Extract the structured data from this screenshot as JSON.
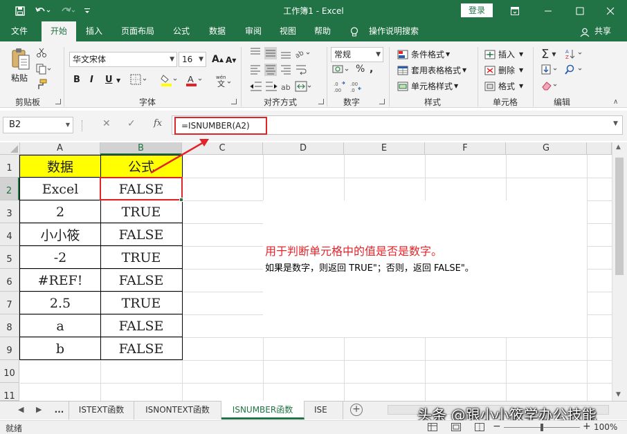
{
  "window": {
    "title": "工作簿1  -  Excel",
    "login_label": "登录"
  },
  "tabs": [
    "文件",
    "开始",
    "插入",
    "页面布局",
    "公式",
    "数据",
    "审阅",
    "视图",
    "帮助"
  ],
  "active_tab": "开始",
  "tell_me": "操作说明搜索",
  "share_label": "共享",
  "ribbon": {
    "clipboard": {
      "paste": "粘贴",
      "label": "剪贴板"
    },
    "font": {
      "name": "华文宋体",
      "size": "16",
      "bold": "B",
      "italic": "I",
      "underline": "U",
      "label": "字体"
    },
    "alignment": {
      "label": "对齐方式"
    },
    "number": {
      "format": "常规",
      "label": "数字"
    },
    "styles": {
      "conditional": "条件格式",
      "table": "套用表格格式",
      "cell": "单元格样式",
      "label": "样式"
    },
    "cells": {
      "insert": "插入",
      "delete": "删除",
      "format": "格式",
      "label": "单元格"
    },
    "editing": {
      "label": "编辑"
    }
  },
  "formula_bar": {
    "name_box": "B2",
    "fx": "fx",
    "formula": "=ISNUMBER(A2)"
  },
  "columns": [
    "A",
    "B",
    "C",
    "D",
    "E",
    "F",
    "G"
  ],
  "rows": [
    "1",
    "2",
    "3",
    "4",
    "5",
    "6",
    "7",
    "8",
    "9",
    "10",
    "11"
  ],
  "table": {
    "headers": [
      "数据",
      "公式"
    ],
    "rows": [
      [
        "Excel",
        "FALSE"
      ],
      [
        "2",
        "TRUE"
      ],
      [
        "小小筱",
        "FALSE"
      ],
      [
        "-2",
        "TRUE"
      ],
      [
        "#REF!",
        "FALSE"
      ],
      [
        "2.5",
        "TRUE"
      ],
      [
        "a",
        "FALSE"
      ],
      [
        "b",
        "FALSE"
      ]
    ]
  },
  "note": {
    "line1": "用于判断单元格中的值是否是数字。",
    "line2": "如果是数字，则返回 TRUE\"；否则，返回 FALSE\"。"
  },
  "sheets": [
    "...",
    "ISTEXT函数",
    "ISNONTEXT函数",
    "ISNUMBER函数",
    "ISE"
  ],
  "active_sheet": "ISNUMBER函数",
  "status": {
    "ready": "就绪",
    "zoom": "100%"
  },
  "watermark": "头条 @跟小小筱学办公技能",
  "colors": {
    "brand": "#217346",
    "header_fill": "#ffff00",
    "annotation_red": "#e0242a"
  }
}
